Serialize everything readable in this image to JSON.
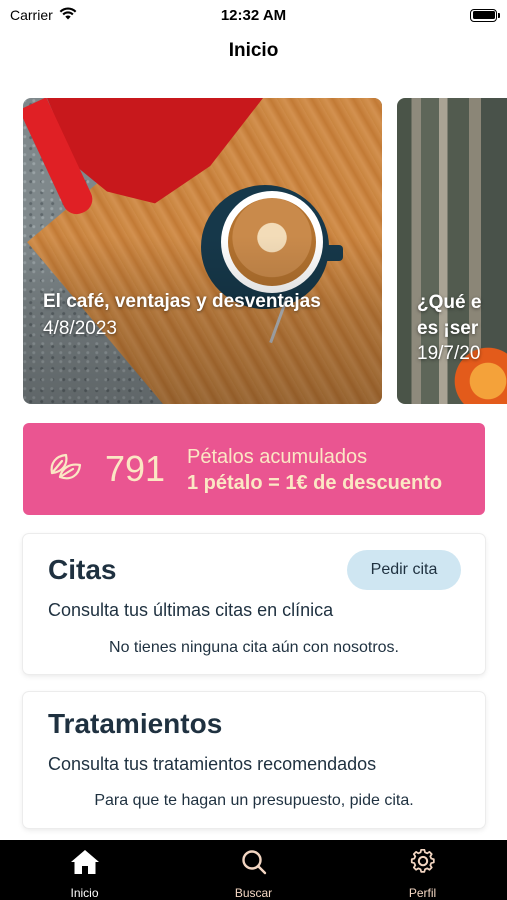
{
  "status_bar": {
    "carrier": "Carrier",
    "time": "12:32 AM"
  },
  "nav": {
    "title": "Inicio"
  },
  "carousel": {
    "items": [
      {
        "title": "El café, ventajas y desventajas",
        "date": "4/8/2023"
      },
      {
        "title": "¿Qué e\nes ¡ser",
        "date": "19/7/20"
      }
    ]
  },
  "petals": {
    "count": "791",
    "label": "Pétalos acumulados",
    "sub": "1 pétalo = 1€ de descuento",
    "icon": "leaf-icon"
  },
  "citas": {
    "title": "Citas",
    "subtitle": "Consulta tus últimas citas en clínica",
    "empty": "No tienes ninguna cita aún con nosotros.",
    "button": "Pedir cita"
  },
  "tratamientos": {
    "title": "Tratamientos",
    "subtitle": "Consulta tus tratamientos recomendados",
    "empty": "Para que te hagan un presupuesto, pide cita."
  },
  "tabs": [
    {
      "label": "Inicio",
      "icon": "home-icon",
      "active": true
    },
    {
      "label": "Buscar",
      "icon": "search-icon",
      "active": false
    },
    {
      "label": "Perfil",
      "icon": "gear-icon",
      "active": false
    }
  ],
  "colors": {
    "accent_pink": "#ea5591",
    "pill_blue": "#cfe6f2",
    "tab_bar": "#000000"
  }
}
